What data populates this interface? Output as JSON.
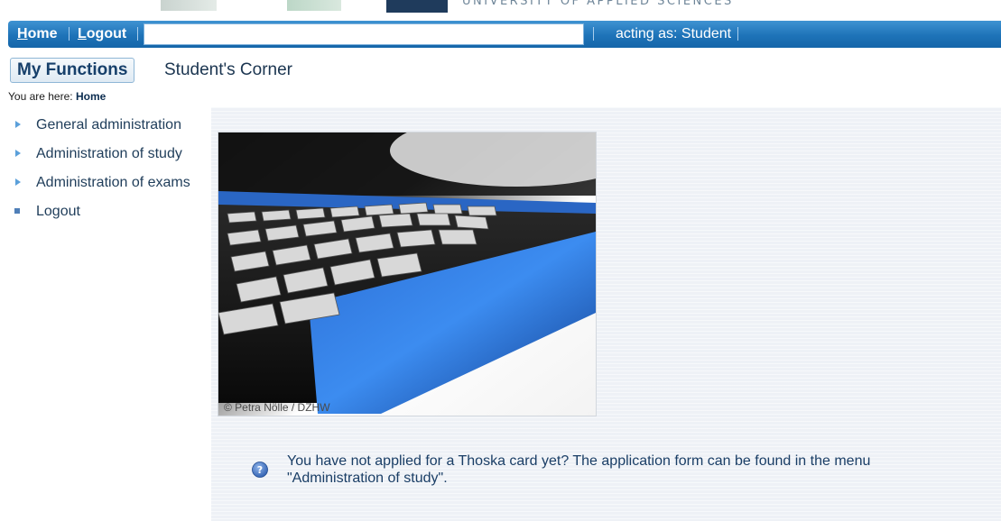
{
  "banner": {
    "university_text": "UNIVERSITY OF APPLIED SCIENCES"
  },
  "navbar": {
    "home": {
      "accel": "H",
      "rest": "ome"
    },
    "logout": {
      "accel": "L",
      "rest": "ogout"
    },
    "search_value": "",
    "acting_as": "acting as: Student"
  },
  "tabs": {
    "my_functions": "My Functions",
    "students_corner": "Student's Corner"
  },
  "breadcrumb": {
    "prefix": "You are here:",
    "current": "Home"
  },
  "menu": {
    "items": [
      {
        "label": "General administration",
        "icon": "triangle-bullet-icon"
      },
      {
        "label": "Administration of study",
        "icon": "triangle-bullet-icon"
      },
      {
        "label": "Administration of exams",
        "icon": "triangle-bullet-icon"
      },
      {
        "label": "Logout",
        "icon": "square-bullet-icon"
      }
    ]
  },
  "content": {
    "image_credit": "© Petra Nölle / DZHW",
    "notice_icon": "help-question-icon",
    "notice_text": "You have not applied for a Thoska card yet? The application form can be found in the menu \"Administration of study\"."
  },
  "colors": {
    "nav_blue": "#1e73b8",
    "tab_text": "#17406b",
    "content_bg": "#eef1f6",
    "notice_text": "#1a3e66"
  }
}
